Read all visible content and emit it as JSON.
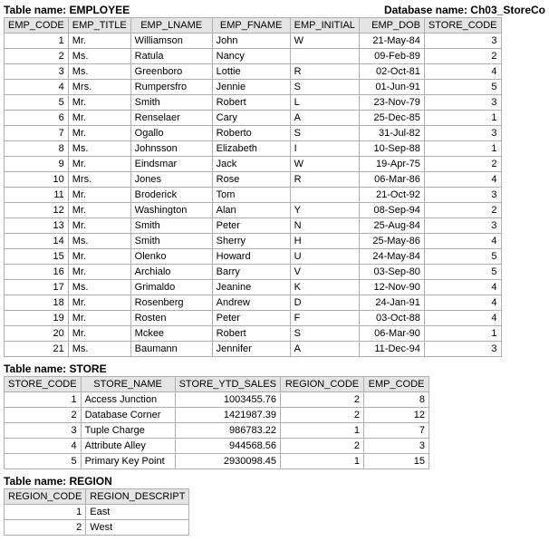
{
  "header": {
    "table_label": "Table name: EMPLOYEE",
    "db_label": "Database name: Ch03_StoreCo"
  },
  "employee": {
    "columns": [
      "EMP_CODE",
      "EMP_TITLE",
      "EMP_LNAME",
      "EMP_FNAME",
      "EMP_INITIAL",
      "EMP_DOB",
      "STORE_CODE"
    ],
    "rows": [
      {
        "code": "1",
        "title": "Mr.",
        "lname": "Williamson",
        "fname": "John",
        "init": "W",
        "dob": "21-May-84",
        "store": "3"
      },
      {
        "code": "2",
        "title": "Ms.",
        "lname": "Ratula",
        "fname": "Nancy",
        "init": "",
        "dob": "09-Feb-89",
        "store": "2"
      },
      {
        "code": "3",
        "title": "Ms.",
        "lname": "Greenboro",
        "fname": "Lottie",
        "init": "R",
        "dob": "02-Oct-81",
        "store": "4"
      },
      {
        "code": "4",
        "title": "Mrs.",
        "lname": "Rumpersfro",
        "fname": "Jennie",
        "init": "S",
        "dob": "01-Jun-91",
        "store": "5"
      },
      {
        "code": "5",
        "title": "Mr.",
        "lname": "Smith",
        "fname": "Robert",
        "init": "L",
        "dob": "23-Nov-79",
        "store": "3"
      },
      {
        "code": "6",
        "title": "Mr.",
        "lname": "Renselaer",
        "fname": "Cary",
        "init": "A",
        "dob": "25-Dec-85",
        "store": "1"
      },
      {
        "code": "7",
        "title": "Mr.",
        "lname": "Ogallo",
        "fname": "Roberto",
        "init": "S",
        "dob": "31-Jul-82",
        "store": "3"
      },
      {
        "code": "8",
        "title": "Ms.",
        "lname": "Johnsson",
        "fname": "Elizabeth",
        "init": "I",
        "dob": "10-Sep-88",
        "store": "1"
      },
      {
        "code": "9",
        "title": "Mr.",
        "lname": "Eindsmar",
        "fname": "Jack",
        "init": "W",
        "dob": "19-Apr-75",
        "store": "2"
      },
      {
        "code": "10",
        "title": "Mrs.",
        "lname": "Jones",
        "fname": "Rose",
        "init": "R",
        "dob": "06-Mar-86",
        "store": "4"
      },
      {
        "code": "11",
        "title": "Mr.",
        "lname": "Broderick",
        "fname": "Tom",
        "init": "",
        "dob": "21-Oct-92",
        "store": "3"
      },
      {
        "code": "12",
        "title": "Mr.",
        "lname": "Washington",
        "fname": "Alan",
        "init": "Y",
        "dob": "08-Sep-94",
        "store": "2"
      },
      {
        "code": "13",
        "title": "Mr.",
        "lname": "Smith",
        "fname": "Peter",
        "init": "N",
        "dob": "25-Aug-84",
        "store": "3"
      },
      {
        "code": "14",
        "title": "Ms.",
        "lname": "Smith",
        "fname": "Sherry",
        "init": "H",
        "dob": "25-May-86",
        "store": "4"
      },
      {
        "code": "15",
        "title": "Mr.",
        "lname": "Olenko",
        "fname": "Howard",
        "init": "U",
        "dob": "24-May-84",
        "store": "5"
      },
      {
        "code": "16",
        "title": "Mr.",
        "lname": "Archialo",
        "fname": "Barry",
        "init": "V",
        "dob": "03-Sep-80",
        "store": "5"
      },
      {
        "code": "17",
        "title": "Ms.",
        "lname": "Grimaldo",
        "fname": "Jeanine",
        "init": "K",
        "dob": "12-Nov-90",
        "store": "4"
      },
      {
        "code": "18",
        "title": "Mr.",
        "lname": "Rosenberg",
        "fname": "Andrew",
        "init": "D",
        "dob": "24-Jan-91",
        "store": "4"
      },
      {
        "code": "19",
        "title": "Mr.",
        "lname": "Rosten",
        "fname": "Peter",
        "init": "F",
        "dob": "03-Oct-88",
        "store": "4"
      },
      {
        "code": "20",
        "title": "Mr.",
        "lname": "Mckee",
        "fname": "Robert",
        "init": "S",
        "dob": "06-Mar-90",
        "store": "1"
      },
      {
        "code": "21",
        "title": "Ms.",
        "lname": "Baumann",
        "fname": "Jennifer",
        "init": "A",
        "dob": "11-Dec-94",
        "store": "3"
      }
    ]
  },
  "store": {
    "caption": "Table name: STORE",
    "columns": [
      "STORE_CODE",
      "STORE_NAME",
      "STORE_YTD_SALES",
      "REGION_CODE",
      "EMP_CODE"
    ],
    "rows": [
      {
        "code": "1",
        "name": "Access Junction",
        "ytd": "1003455.76",
        "region": "2",
        "emp": "8"
      },
      {
        "code": "2",
        "name": "Database Corner",
        "ytd": "1421987.39",
        "region": "2",
        "emp": "12"
      },
      {
        "code": "3",
        "name": "Tuple Charge",
        "ytd": "986783.22",
        "region": "1",
        "emp": "7"
      },
      {
        "code": "4",
        "name": "Attribute Alley",
        "ytd": "944568.56",
        "region": "2",
        "emp": "3"
      },
      {
        "code": "5",
        "name": "Primary Key Point",
        "ytd": "2930098.45",
        "region": "1",
        "emp": "15"
      }
    ]
  },
  "region": {
    "caption": "Table name: REGION",
    "columns": [
      "REGION_CODE",
      "REGION_DESCRIPT"
    ],
    "rows": [
      {
        "code": "1",
        "desc": "East"
      },
      {
        "code": "2",
        "desc": "West"
      }
    ]
  }
}
